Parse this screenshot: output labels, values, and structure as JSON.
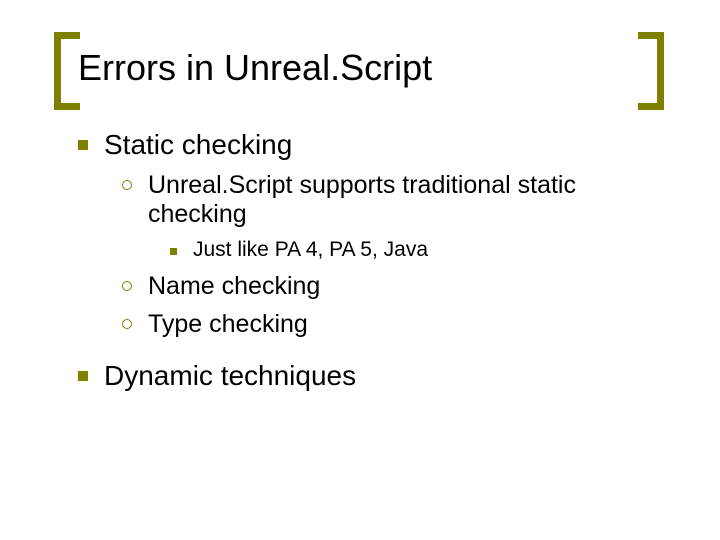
{
  "title": "Errors in Unreal.Script",
  "body": {
    "items": [
      {
        "label": "Static checking",
        "children": [
          {
            "label": "Unreal.Script supports traditional static checking",
            "children": [
              {
                "label": "Just like PA 4, PA 5, Java"
              }
            ]
          },
          {
            "label": "Name checking"
          },
          {
            "label": "Type checking"
          }
        ]
      },
      {
        "label": "Dynamic techniques"
      }
    ]
  }
}
